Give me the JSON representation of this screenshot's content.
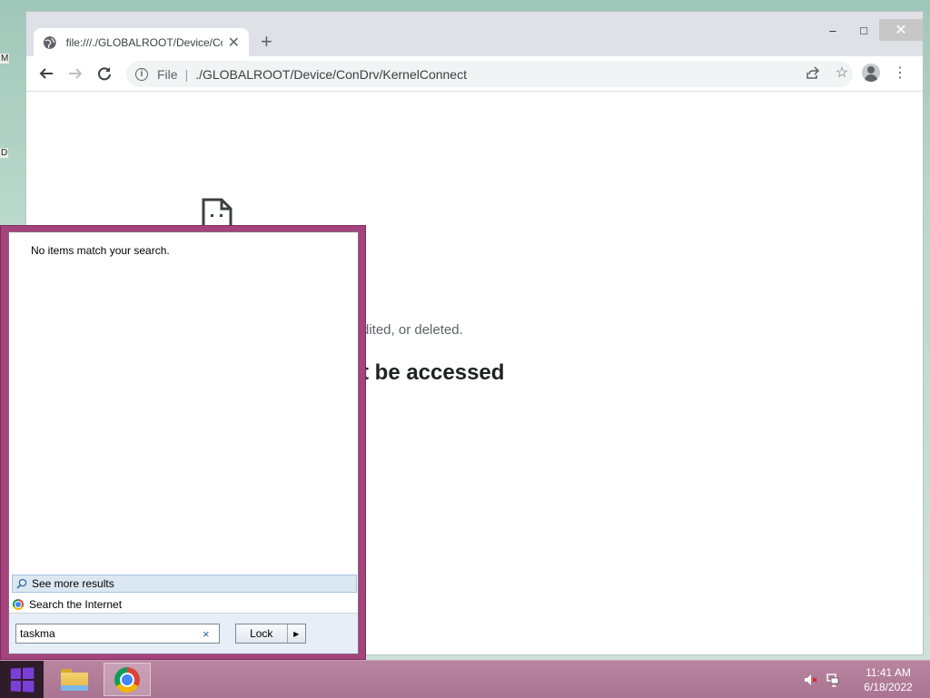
{
  "desktop": {
    "glyph_1": "M",
    "glyph_2": "D"
  },
  "browser": {
    "tab_title": "file:///./GLOBALROOT/Device/ConDrv/KernelConnect",
    "new_tab": "+",
    "window_controls": {
      "minimize": "–",
      "maximize": "□",
      "close": "✕"
    },
    "omnibox": {
      "scheme_label": "File",
      "separator": "|",
      "url": "./GLOBALROOT/Device/ConDrv/KernelConnect"
    },
    "error": {
      "title": "t be accessed",
      "subtitle": "dited, or deleted."
    }
  },
  "start_menu": {
    "no_items": "No items match your search.",
    "see_more": "See more results",
    "search_internet": "Search the Internet",
    "search_value": "taskma",
    "clear": "×",
    "lock_label": "Lock",
    "lock_arrow": "▶"
  },
  "taskbar": {
    "time": "11:41 AM",
    "date": "6/18/2022"
  },
  "colors": {
    "start_menu_frame": "#a4437c",
    "taskbar": "#b17a97",
    "start_button": "#2f1c2b",
    "windows_logo": "#7a3fd6"
  }
}
